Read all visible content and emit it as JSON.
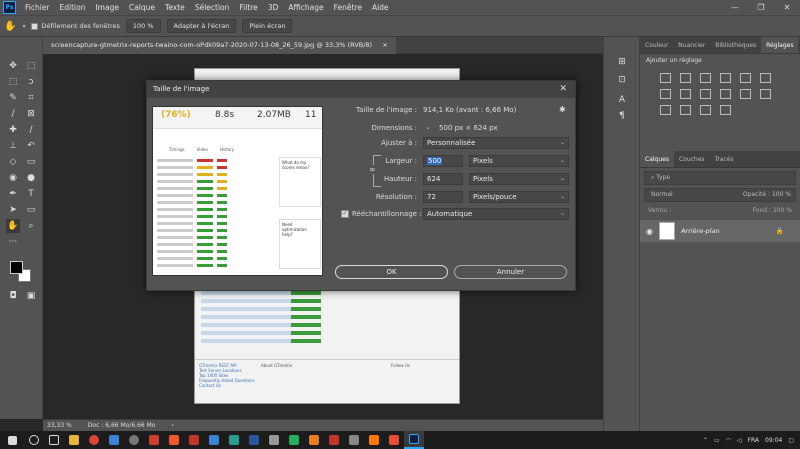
{
  "app": {
    "logo": "Ps",
    "menu": [
      "Fichier",
      "Edition",
      "Image",
      "Calque",
      "Texte",
      "Sélection",
      "Filtre",
      "3D",
      "Affichage",
      "Fenêtre",
      "Aide"
    ],
    "window_controls": [
      "—",
      "❐",
      "✕"
    ]
  },
  "options": {
    "scroll_all_label": "Défilement des fenêtres",
    "zoom_value": "100 %",
    "fit_screen": "Adapter à l'écran",
    "full_screen": "Plein écran"
  },
  "document": {
    "tab_title": "screencapture-gtmetrix-reports-twaino-com-oPdk09a7-2020-07-13-08_26_59.jpg @ 33,3% (RVB/8)",
    "tab_close": "×",
    "zoom": "33,33 %",
    "doc_info": "Doc : 6,66 Mo/6,66 Mo",
    "status_arrow": "›"
  },
  "panels": {
    "top_tabs": [
      "Couleur",
      "Nuancier",
      "Bibliothèques",
      "Réglages"
    ],
    "active_top_tab": "Réglages",
    "adjust_label": "Ajouter un réglage",
    "layer_tabs": [
      "Calques",
      "Couches",
      "Tracés"
    ],
    "layer_search_placeholder": "Type",
    "blend_mode": "Normal",
    "opacity_label": "Opacité :",
    "opacity_value": "100 %",
    "lock_label": "Verrou :",
    "fill_label": "Fond :",
    "fill_value": "100 %",
    "layer_name": "Arrière-plan"
  },
  "dialog": {
    "title": "Taille de l'image",
    "close": "✕",
    "image_size_label": "Taille de l'image :",
    "image_size_value": "914,1 Ko (avant : 6,66 Mo)",
    "dimensions_label": "Dimensions :",
    "dimensions_value": "500 px  ×  624 px",
    "fit_label": "Ajuster à :",
    "fit_value": "Personnalisée",
    "width_label": "Largeur :",
    "width_value": "500",
    "width_unit": "Pixels",
    "height_label": "Hauteur :",
    "height_value": "624",
    "height_unit": "Pixels",
    "resolution_label": "Résolution :",
    "resolution_value": "72",
    "resolution_unit": "Pixels/pouce",
    "resample_label": "Rééchantillonnage :",
    "resample_value": "Automatique",
    "ok_label": "OK",
    "cancel_label": "Annuler",
    "gear_icon": "✱"
  },
  "preview": {
    "grade": "(76%)",
    "time": "8.8s",
    "size": "2.07MB",
    "requests": "11",
    "tabs": [
      "",
      "Timings",
      "Video",
      "History"
    ],
    "side_title_1": "What do my scores mean?",
    "side_title_2": "Need optimization help?"
  },
  "page": {
    "footer_col1_title": "GTmetrix REST API",
    "footer_col1": [
      "Test Server Locations",
      "Top 1000 Sites",
      "Frequently Asked Questions",
      "Contact Us"
    ],
    "footer_col2_title": "About GTmetrix",
    "footer_col3_title": "Follow Us"
  },
  "taskbar": {
    "lang": "FRA",
    "time": "09:04"
  },
  "colors": {
    "accent": "#31a8ff",
    "green": "#3a9b3a",
    "yellow": "#e0b020",
    "red": "#cc3333"
  }
}
